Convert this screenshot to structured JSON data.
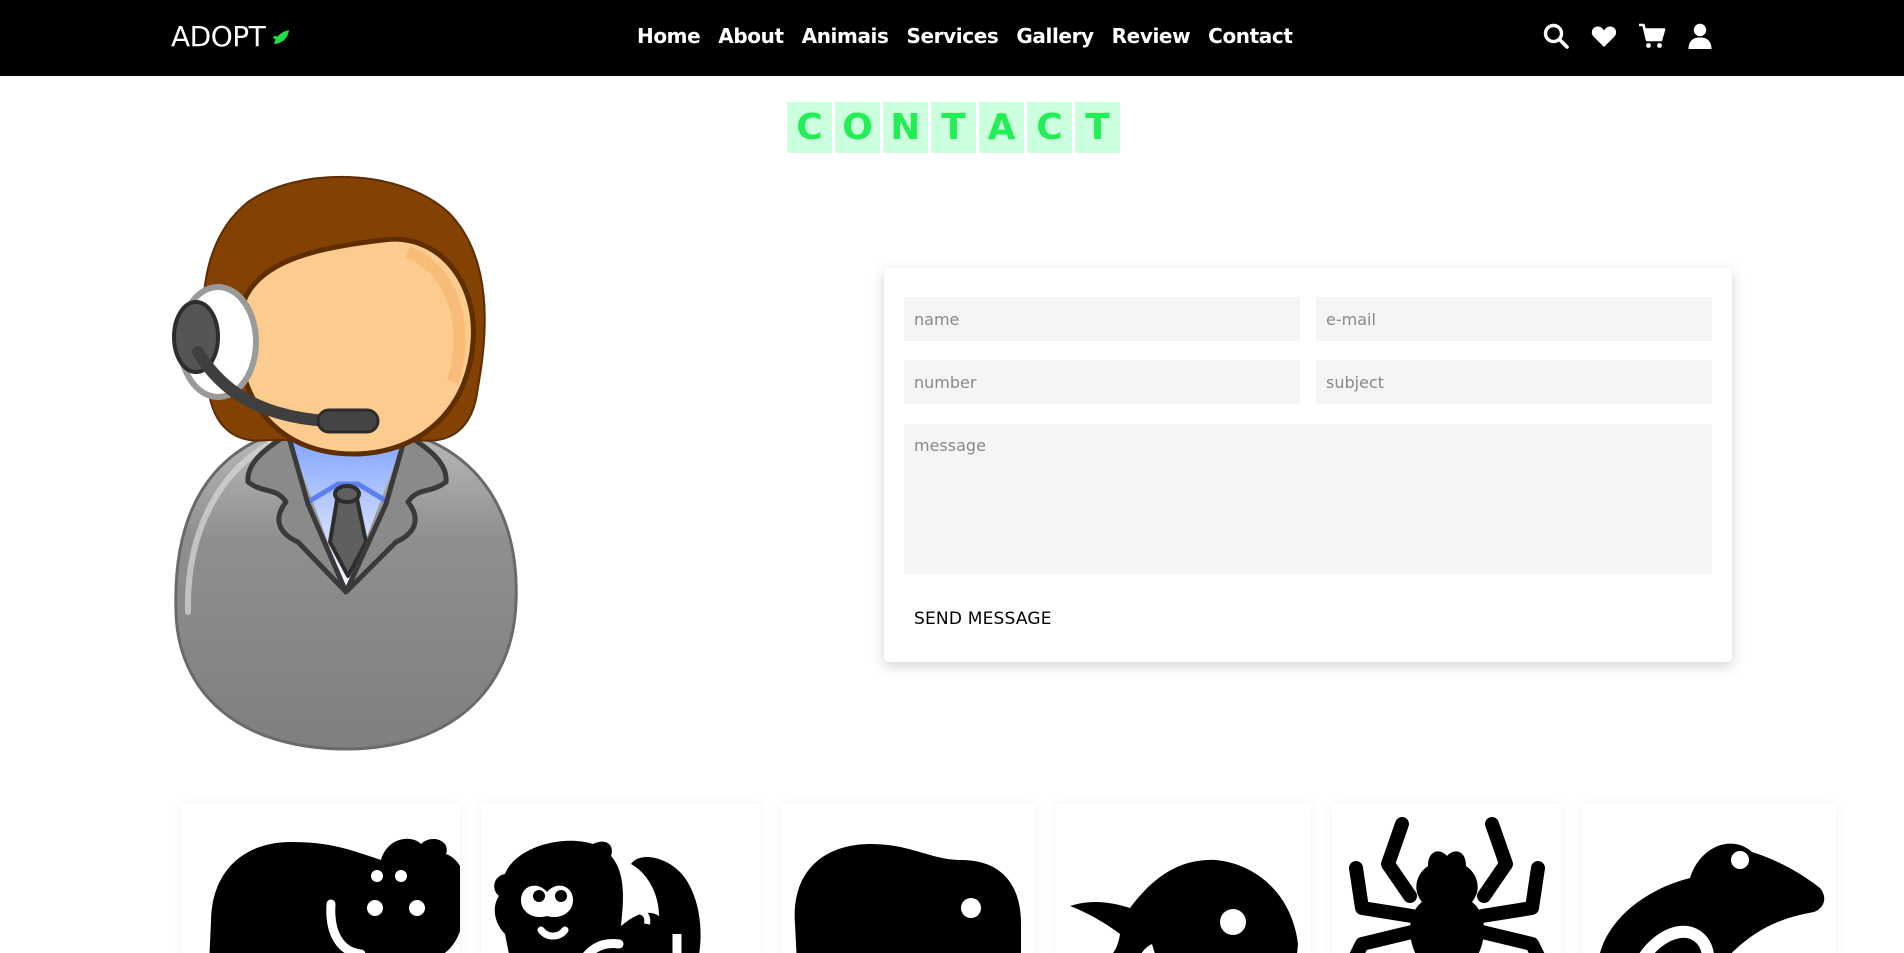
{
  "brand": {
    "name": "ADOPT",
    "leaf_icon": "leaf-icon",
    "leaf_color": "#22dd44"
  },
  "nav": {
    "links": [
      {
        "label": "Home"
      },
      {
        "label": "About"
      },
      {
        "label": "Animais"
      },
      {
        "label": "Services"
      },
      {
        "label": "Gallery"
      },
      {
        "label": "Review"
      },
      {
        "label": "Contact"
      }
    ],
    "icons": [
      "search-icon",
      "heart-icon",
      "cart-icon",
      "user-icon"
    ]
  },
  "heading": {
    "letters": [
      "C",
      "O",
      "N",
      "T",
      "A",
      "C",
      "T"
    ],
    "letter_bg": "#ccffdd",
    "letter_color": "#22ee55"
  },
  "form": {
    "name_placeholder": "name",
    "email_placeholder": "e-mail",
    "number_placeholder": "number",
    "subject_placeholder": "subject",
    "message_placeholder": "message",
    "send_label": "SEND MESSAGE"
  },
  "animals": [
    "hippo-icon",
    "otter-icon",
    "seal-icon",
    "fish-icon",
    "spider-icon",
    "frog-icon"
  ]
}
